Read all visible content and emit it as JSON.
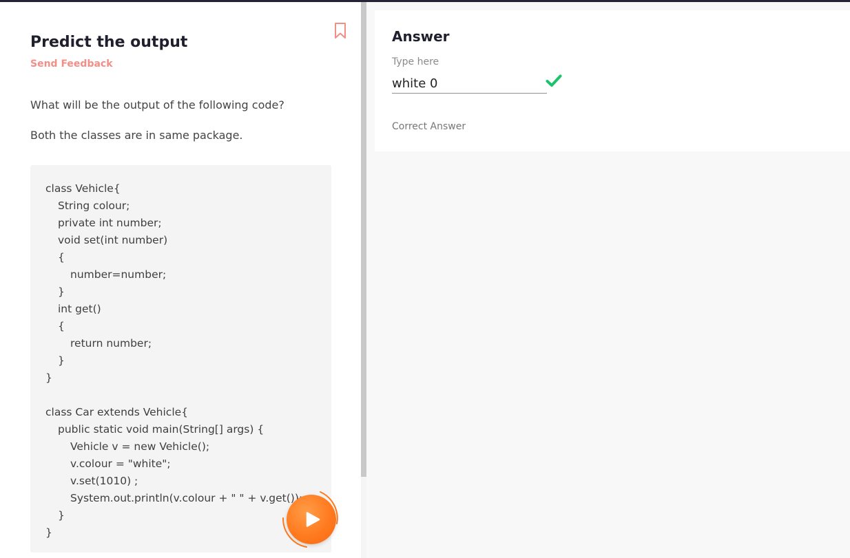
{
  "question": {
    "title": "Predict the output",
    "feedback_link": "Send Feedback",
    "prompt": "What will be the output of the following code?",
    "note": "Both the classes are in same package.",
    "code_lines": [
      "class Vehicle{",
      "String colour;",
      "private int number;",
      "void set(int number)",
      "{",
      "number=number;",
      "}",
      "int get()",
      "{",
      "return number;",
      "}",
      "}",
      "class Car extends Vehicle{",
      "public static void main(String[] args) {",
      "Vehicle v = new Vehicle();",
      "v.colour = \"white\";",
      "v.set(1010) ;",
      "System.out.println(v.colour + \" \" + v.get());",
      "}",
      "}"
    ]
  },
  "answer": {
    "title": "Answer",
    "field_label": "Type here",
    "value": "white 0",
    "result": "Correct Answer"
  },
  "icons": {
    "bookmark": "bookmark-icon",
    "check": "check-icon",
    "play": "play-icon"
  },
  "colors": {
    "accent_orange": "#ff7a1f",
    "feedback_pink": "#f38e87",
    "success_green": "#1bc46a"
  }
}
